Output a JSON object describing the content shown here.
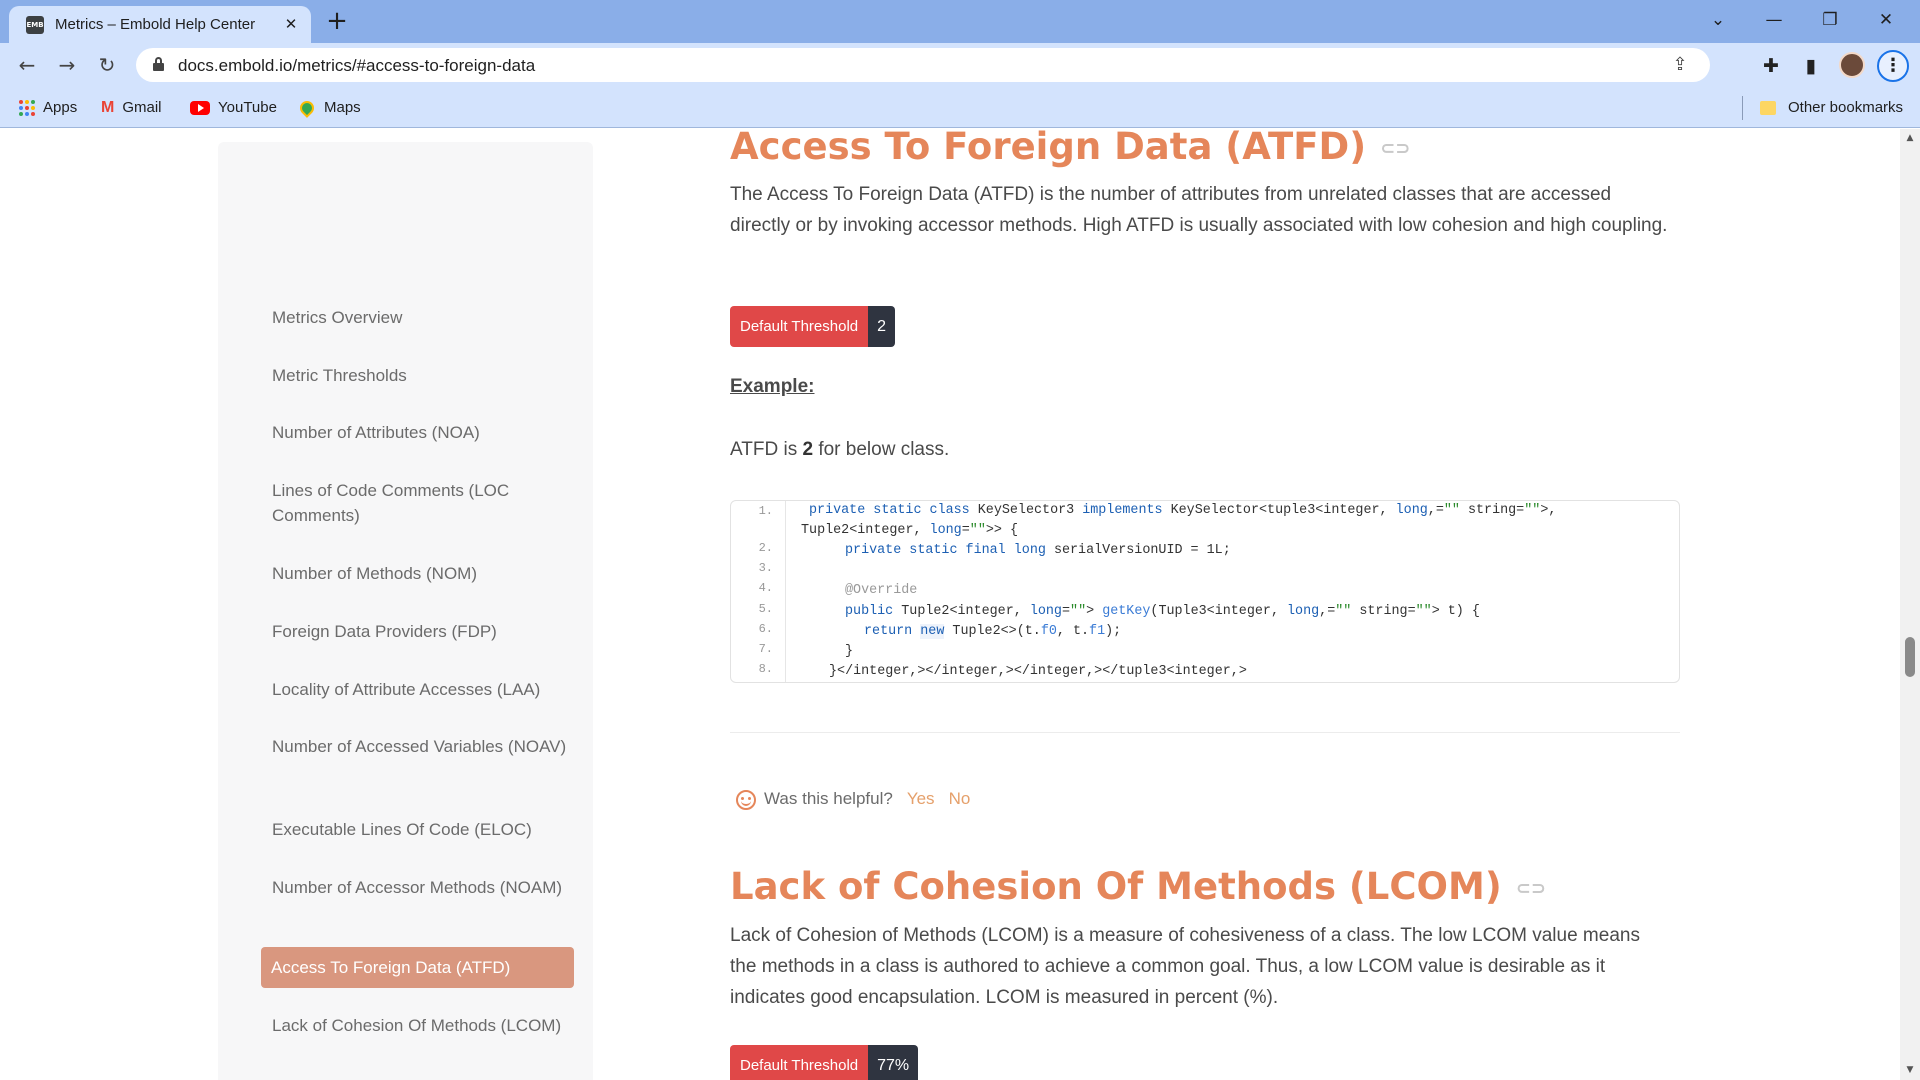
{
  "browser": {
    "tab": {
      "title": "Metrics – Embold Help Center",
      "favicon_text": "EMB"
    },
    "url": "docs.embold.io/metrics/#access-to-foreign-data",
    "bookmarks": [
      {
        "label": "Apps"
      },
      {
        "label": "Gmail"
      },
      {
        "label": "YouTube"
      },
      {
        "label": "Maps"
      }
    ],
    "other_bookmarks": "Other bookmarks"
  },
  "sidebar": {
    "items": [
      {
        "label": "Metrics Overview",
        "active": false
      },
      {
        "label": "Metric Thresholds",
        "active": false
      },
      {
        "label": "Number of Attributes (NOA)",
        "active": false
      },
      {
        "label": "Lines of Code Comments (LOC Comments)",
        "active": false
      },
      {
        "label": "Number of Methods (NOM)",
        "active": false
      },
      {
        "label": "Foreign Data Providers (FDP)",
        "active": false
      },
      {
        "label": "Locality of Attribute Accesses (LAA)",
        "active": false
      },
      {
        "label": "Number of Accessed Variables (NOAV)",
        "active": false
      },
      {
        "label": "Executable Lines Of Code (ELOC)",
        "active": false
      },
      {
        "label": "Number of Accessor Methods (NOAM)",
        "active": false
      },
      {
        "label": "Access To Foreign Data (ATFD)",
        "active": true
      },
      {
        "label": "Lack of Cohesion Of Methods (LCOM)",
        "active": false
      }
    ]
  },
  "sections": {
    "atfd": {
      "title": "Access To Foreign Data (ATFD)",
      "description": "The Access To Foreign Data (ATFD) is the number of attributes from unrelated classes that are accessed directly or by invoking accessor methods. High ATFD is usually associated with low cohesion and high coupling.",
      "threshold_label": "Default Threshold",
      "threshold_value": "2",
      "example_heading": "Example:",
      "example_prefix": "ATFD is ",
      "example_value": "2",
      "example_suffix": " for below class.",
      "code_lines": [
        {
          "n": "1.",
          "text": ""
        },
        {
          "n": "2.",
          "text": ""
        },
        {
          "n": "3.",
          "text": ""
        },
        {
          "n": "4.",
          "text": ""
        },
        {
          "n": "5.",
          "text": ""
        },
        {
          "n": "6.",
          "text": ""
        },
        {
          "n": "7.",
          "text": ""
        },
        {
          "n": "8.",
          "text": ""
        }
      ]
    },
    "feedback": {
      "question": "Was this helpful?",
      "yes": "Yes",
      "no": "No"
    },
    "lcom": {
      "title": "Lack of Cohesion Of Methods (LCOM)",
      "description": "Lack of Cohesion of Methods (LCOM) is a measure of cohesiveness of a class. The low LCOM value means the methods in a class is authored to achieve a common goal. Thus, a low LCOM value is desirable as it indicates good encapsulation. LCOM is measured in percent (%).",
      "threshold_label": "Default Threshold",
      "threshold_value": "77%"
    }
  },
  "colors": {
    "heading": "#e5865a",
    "active_nav": "#d9977f",
    "threshold_label_bg": "#e04848",
    "threshold_value_bg": "#2f3440",
    "chrome_tabbar": "#8aaee8",
    "chrome_toolbar": "#d3e3fd"
  },
  "icons": {
    "tab_close": "close-icon",
    "new_tab": "plus-icon",
    "back": "back-arrow-icon",
    "forward": "forward-arrow-icon",
    "reload": "reload-icon",
    "share": "share-icon",
    "bookmark_star": "star-icon",
    "extensions": "puzzle-icon",
    "side_panel": "side-panel-icon",
    "heading_anchor": "link-icon",
    "feedback": "smiley-icon"
  }
}
